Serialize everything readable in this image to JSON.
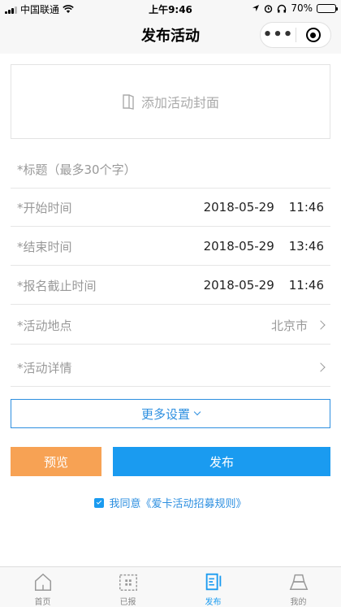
{
  "status_bar": {
    "carrier": "中国联通",
    "time": "上午9:46",
    "battery": "70%",
    "battery_level": 0.7
  },
  "nav": {
    "title": "发布活动",
    "more_label": "•••"
  },
  "cover": {
    "placeholder": "添加活动封面",
    "icon": "book-icon"
  },
  "form": {
    "title_placeholder": "*标题（最多30个字）",
    "start_label": "*开始时间",
    "start_date": "2018-05-29",
    "start_time": "11:46",
    "end_label": "*结束时间",
    "end_date": "2018-05-29",
    "end_time": "13:46",
    "deadline_label": "*报名截止时间",
    "deadline_date": "2018-05-29",
    "deadline_time": "11:46",
    "location_label": "*活动地点",
    "location_value": "北京市",
    "details_label": "*活动详情"
  },
  "more_settings": "更多设置",
  "buttons": {
    "preview": "预览",
    "publish": "发布"
  },
  "agreement": {
    "checked": true,
    "text": "我同意《爱卡活动招募规则》"
  },
  "tabs": [
    {
      "label": "首页",
      "icon": "home-icon",
      "active": false
    },
    {
      "label": "已报",
      "icon": "registered-icon",
      "active": false
    },
    {
      "label": "发布",
      "icon": "publish-icon",
      "active": true
    },
    {
      "label": "我的",
      "icon": "profile-icon",
      "active": false
    }
  ],
  "colors": {
    "accent": "#1a9bf0",
    "preview": "#f7a254",
    "border_blue": "#2d8fe0"
  }
}
